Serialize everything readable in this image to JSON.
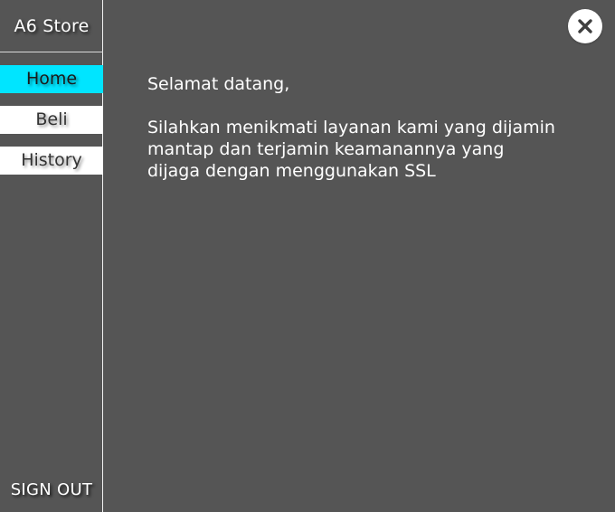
{
  "sidebar": {
    "brand": "A6 Store",
    "items": [
      {
        "label": "Home",
        "active": true
      },
      {
        "label": "Beli",
        "active": false
      },
      {
        "label": "History",
        "active": false
      }
    ],
    "signout_label": "SIGN OUT"
  },
  "header": {
    "close_icon": "close-icon"
  },
  "main": {
    "greeting": "Selamat datang,",
    "message": "Silahkan menikmati layanan kami yang dijamin mantap dan terjamin keamanannya yang dijaga dengan menggunakan SSL"
  },
  "colors": {
    "background": "#555555",
    "active_accent": "#00e5ff",
    "button_background": "#ffffff"
  }
}
